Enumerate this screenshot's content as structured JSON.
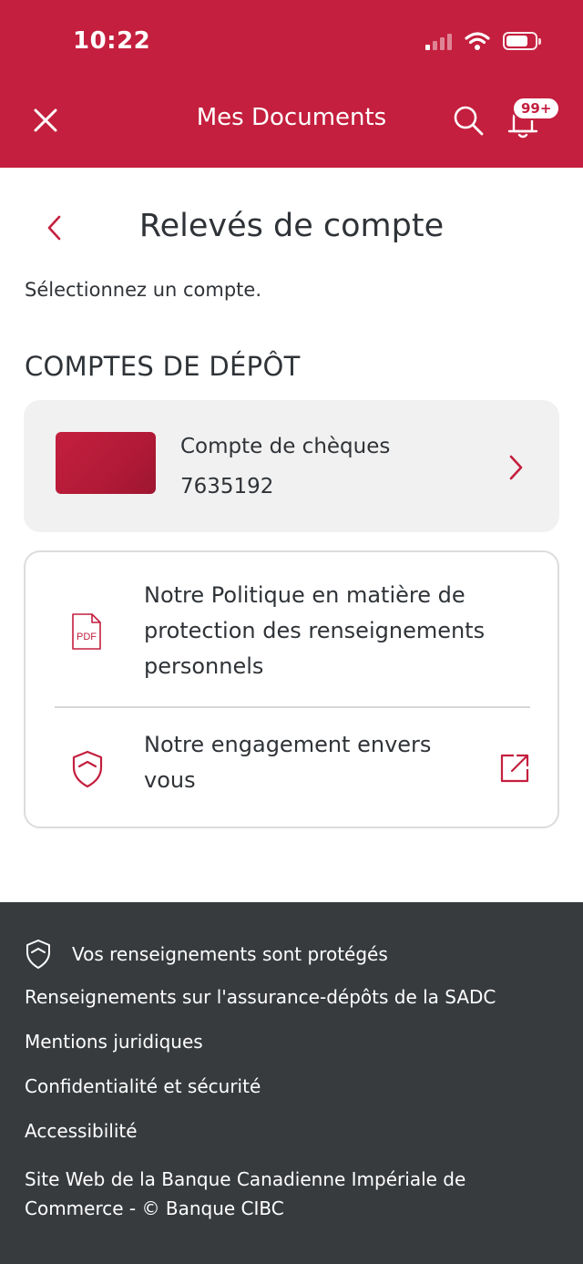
{
  "status_bar": {
    "time": "10:22",
    "signal_bars_active": 1,
    "battery_level": 0.7
  },
  "header": {
    "title": "Mes Documents",
    "notification_badge": "99+",
    "close_icon": "close-icon",
    "search_icon": "search-icon",
    "bell_icon": "bell-icon"
  },
  "page": {
    "title": "Relevés de compte",
    "instruction": "Sélectionnez un compte.",
    "section_title": "COMPTES DE DÉPÔT"
  },
  "account": {
    "name": "Compte de chèques",
    "number": "7635192"
  },
  "links": {
    "privacy_policy": "Notre Politique en matière de protection des renseignements personnels",
    "pdf_label": "PDF",
    "commitment": "Notre engagement envers vous"
  },
  "footer": {
    "secure_text": "Vos renseignements sont protégés",
    "link_sadc": "Renseignements sur l'assurance-dépôts de la SADC",
    "link_legal": "Mentions juridiques",
    "link_privacy": "Confidentialité et sécurité",
    "link_accessibility": "Accessibilité",
    "copyright": "Site Web de la Banque Canadienne Impériale de Commerce - © Banque CIBC"
  },
  "colors": {
    "brand_red": "#c41f3e",
    "footer_bg": "#383b3e",
    "card_bg": "#f1f1f1"
  }
}
